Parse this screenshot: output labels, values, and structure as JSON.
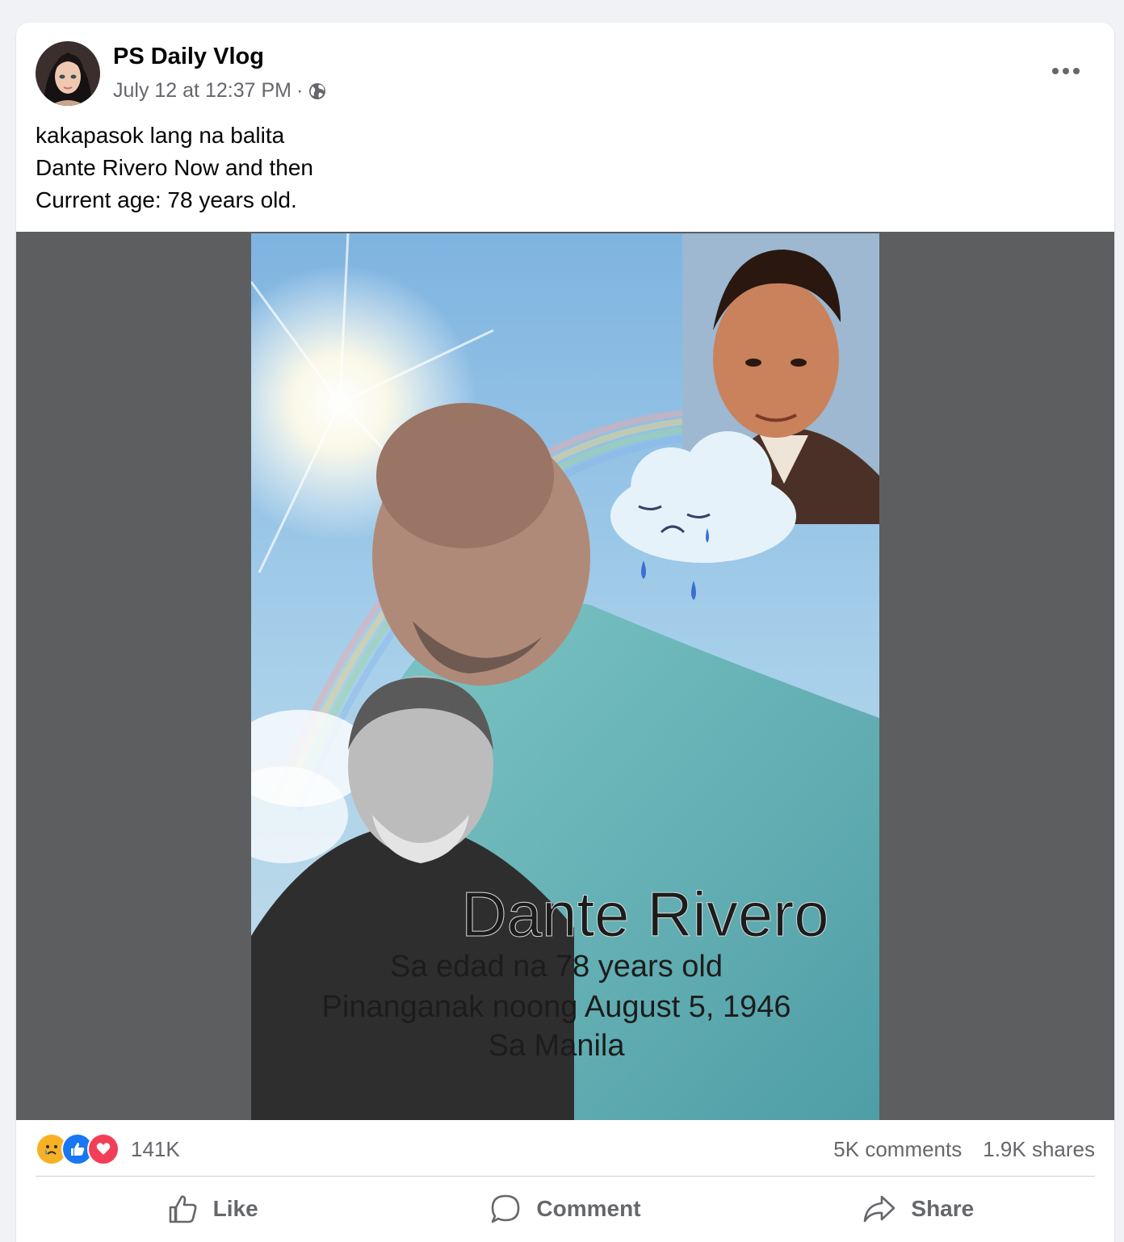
{
  "post": {
    "author": "PS Daily Vlog",
    "timestamp": "July 12 at 12:37 PM",
    "separator": "·",
    "audience_icon": "globe-icon",
    "text_lines": [
      "kakapasok lang na balita",
      "Dante Rivero Now and then",
      "Current age: 78 years old."
    ],
    "image": {
      "title": "Dante Rivero",
      "lines": [
        "Sa edad na 78 years old",
        "Pinanganak noong August 5, 1946",
        "Sa Manila"
      ]
    }
  },
  "reactions": {
    "icons": [
      "sad-reaction-icon",
      "like-reaction-icon",
      "love-reaction-icon"
    ],
    "count": "141K",
    "comments": "5K comments",
    "shares": "1.9K shares"
  },
  "actions": {
    "like": "Like",
    "comment": "Comment",
    "share": "Share"
  },
  "colors": {
    "secondary_text": "#65676b",
    "like_blue": "#1877f2",
    "love_red": "#f33e58",
    "sad_yellow": "#f7b125",
    "media_bg": "#5d5e60"
  }
}
